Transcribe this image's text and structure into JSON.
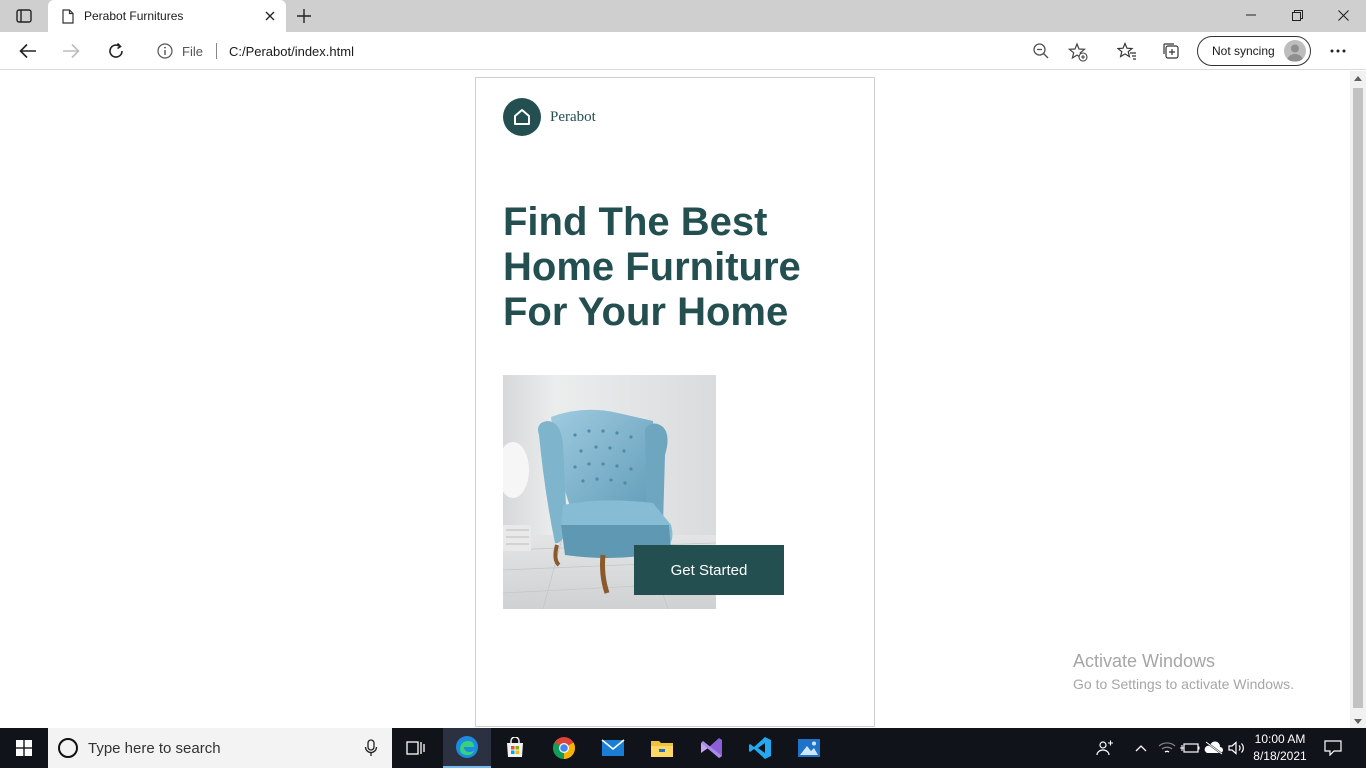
{
  "browser": {
    "tab_title": "Perabot Furnitures",
    "address_scheme": "File",
    "url": "C:/Perabot/index.html",
    "sync_label": "Not syncing"
  },
  "page": {
    "brand_name": "Perabot",
    "headline_line1_light": "Find The ",
    "headline_line1_bold": "Best",
    "headline_line2_bold": "Home Furniture",
    "headline_line3_light": "For Your Home",
    "cta_label": "Get Started",
    "accent_color": "#234f51"
  },
  "watermark": {
    "title": "Activate Windows",
    "subtitle": "Go to Settings to activate Windows."
  },
  "taskbar": {
    "search_placeholder": "Type here to search",
    "time": "10:00 AM",
    "date": "8/18/2021",
    "apps": [
      "task-view-icon",
      "edge-icon",
      "store-icon",
      "chrome-icon",
      "mail-icon",
      "file-explorer-icon",
      "visual-studio-icon",
      "vscode-icon",
      "photos-icon"
    ]
  }
}
